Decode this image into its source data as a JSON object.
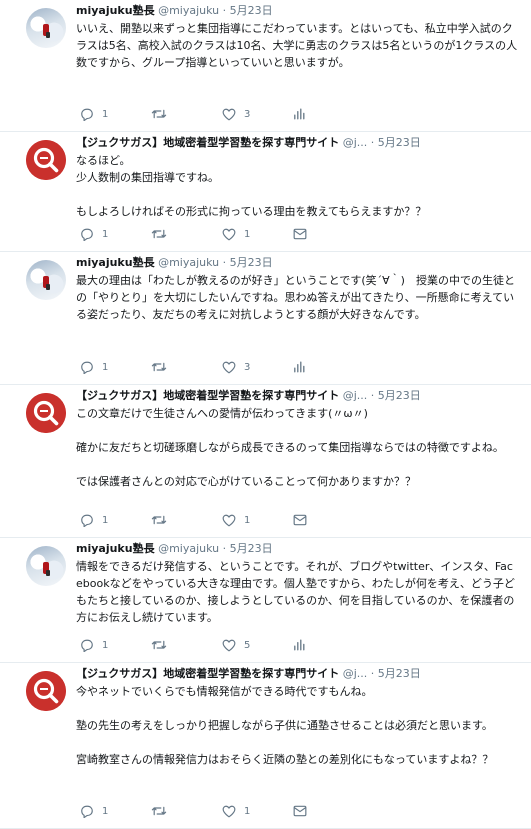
{
  "tweets": [
    {
      "name": "miyajuku塾長",
      "handle": "@miyajuku",
      "date": "5月23日",
      "avatar": "snow-avatar",
      "body": "いいえ、開塾以来ずっと集団指導にこだわっています。とはいっても、私立中学入試のクラスは5名、高校入試のクラスは10名、大学に勇志のクラスは5名というのが1クラスの人数ですから、グループ指導といっていいと思いますが。",
      "reply": "1",
      "retweet": "",
      "like": "3",
      "last_icon": "analytics-icon"
    },
    {
      "name": "【ジュクサガス】地域密着型学習塾を探す専門サイト",
      "handle": "@j...",
      "date": "5月23日",
      "avatar": "jukusagasu-logo",
      "body": "なるほど。\n少人数制の集団指導ですね。\n\nもしよろしければその形式に拘っている理由を教えてもらえますか？？",
      "reply": "1",
      "retweet": "",
      "like": "1",
      "last_icon": "mail-icon"
    },
    {
      "name": "miyajuku塾長",
      "handle": "@miyajuku",
      "date": "5月23日",
      "avatar": "snow-avatar",
      "body": "最大の理由は「わたしが教えるのが好き」ということです(笑´∀｀)　授業の中での生徒との「やりとり」を大切にしたいんですね。思わぬ答えが出てきたり、一所懸命に考えている姿だったり、友だちの考えに対抗しようとする顔が大好きなんです。",
      "reply": "1",
      "retweet": "",
      "like": "3",
      "last_icon": "analytics-icon"
    },
    {
      "name": "【ジュクサガス】地域密着型学習塾を探す専門サイト",
      "handle": "@j...",
      "date": "5月23日",
      "avatar": "jukusagasu-logo",
      "body": "この文章だけで生徒さんへの愛情が伝わってきます(〃ω〃)\n\n確かに友だちと切磋琢磨しながら成長できるのって集団指導ならではの特徴ですよね。\n\nでは保護者さんとの対応で心がけていることって何かありますか？？",
      "reply": "1",
      "retweet": "",
      "like": "1",
      "last_icon": "mail-icon"
    },
    {
      "name": "miyajuku塾長",
      "handle": "@miyajuku",
      "date": "5月23日",
      "avatar": "snow-avatar",
      "body": "情報をできるだけ発信する、ということです。それが、ブログやtwitter、インスタ、Facebookなどをやっている大きな理由です。個人塾ですから、わたしが何を考え、どう子どもたちと接しているのか、接しようとしているのか、何を目指しているのか、を保護者の方にお伝えし続けています。",
      "reply": "1",
      "retweet": "",
      "like": "5",
      "last_icon": "analytics-icon"
    },
    {
      "name": "【ジュクサガス】地域密着型学習塾を探す専門サイト",
      "handle": "@j...",
      "date": "5月23日",
      "avatar": "jukusagasu-logo",
      "body": "今やネットでいくらでも情報発信ができる時代ですもんね。\n\n塾の先生の考えをしっかり把握しながら子供に通塾させることは必須だと思います。\n\n宮崎教室さんの情報発信力はおそらく近隣の塾との差別化にもなっていますよね？？",
      "reply": "1",
      "retweet": "",
      "like": "1",
      "last_icon": "mail-icon"
    }
  ],
  "colors": {
    "text": "#14171a",
    "muted": "#657786",
    "divider": "#e6ecf0",
    "logo_red": "#c9302c"
  }
}
